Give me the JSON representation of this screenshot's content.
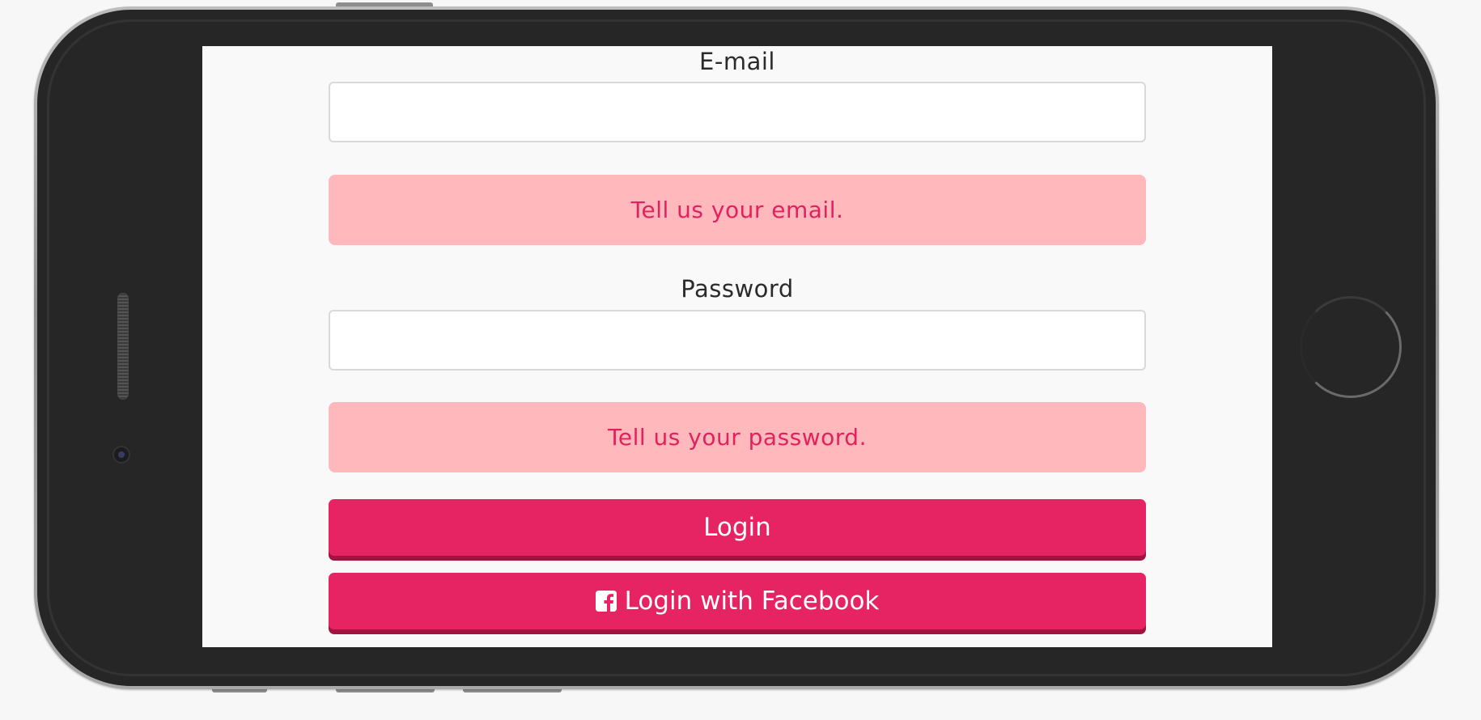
{
  "login_form": {
    "email_label": "E-mail",
    "email_value": "",
    "email_error": "Tell us your email.",
    "password_label": "Password",
    "password_value": "",
    "password_error": "Tell us your password.",
    "login_button": "Login",
    "facebook_button": "Login with Facebook",
    "facebook_icon": "facebook-square-icon"
  },
  "colors": {
    "accent": "#e62463",
    "accent_shadow": "#a1143f",
    "error_background": "#ffb8bb",
    "error_text": "#e2215f",
    "screen_background": "#f9f9f9"
  }
}
